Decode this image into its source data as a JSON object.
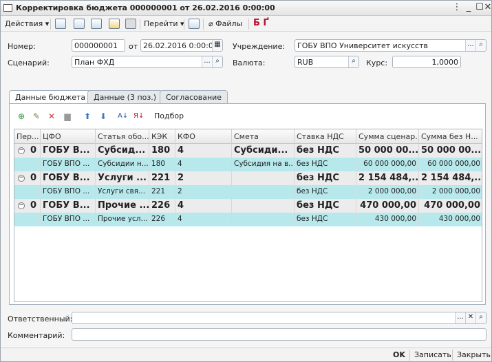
{
  "window": {
    "title": "Корректировка бюджета 000000001 от 26.02.2016 0:00:00"
  },
  "toolbar": {
    "actions": "Действия",
    "goto": "Перейти",
    "files": "Файлы"
  },
  "form": {
    "number_label": "Номер:",
    "number": "000000001",
    "date_label": "от",
    "date": "26.02.2016  0:00:00",
    "org_label": "Учреждение:",
    "org": "ГОБУ ВПО Университет искусств",
    "scenario_label": "Сценарий:",
    "scenario": "План ФХД",
    "currency_label": "Валюта:",
    "currency": "RUB",
    "rate_label": "Курс:",
    "rate": "1,0000"
  },
  "tabs": [
    "Данные бюджета",
    "Данные (3 поз.)",
    "Согласование"
  ],
  "grid_toolbar": {
    "pick": "Подбор"
  },
  "columns": [
    "Пер...",
    "ЦФО",
    "Статья обо...",
    "КЭК",
    "КФО",
    "Смета",
    "Ставка НДС",
    "Сумма сценар...",
    "Сумма без Н..."
  ],
  "rows": [
    {
      "type": "grp",
      "per": "0",
      "cfo": "ГОБУ В...",
      "stat": "Субсид...",
      "kek": "180",
      "kfo": "4",
      "smeta": "Субсиди...",
      "nds": "без НДС",
      "sum": "50 000 00...",
      "sumbn": "50 000 00..."
    },
    {
      "type": "det",
      "per": "",
      "cfo": "ГОБУ ВПО ...",
      "stat": "Субсидии н...",
      "kek": "180",
      "kfo": "4",
      "smeta": "Субсидия на в...",
      "nds": "без НДС",
      "sum": "60 000 000,00",
      "sumbn": "60 000 000,00"
    },
    {
      "type": "grp",
      "per": "0",
      "cfo": "ГОБУ В...",
      "stat": "Услуги ...",
      "kek": "221",
      "kfo": "2",
      "smeta": "",
      "nds": "без НДС",
      "sum": "2 154 484,...",
      "sumbn": "2 154 484,..."
    },
    {
      "type": "det",
      "per": "",
      "cfo": "ГОБУ ВПО ...",
      "stat": "Услуги свя...",
      "kek": "221",
      "kfo": "2",
      "smeta": "",
      "nds": "без НДС",
      "sum": "2 000 000,00",
      "sumbn": "2 000 000,00"
    },
    {
      "type": "grp",
      "per": "0",
      "cfo": "ГОБУ В...",
      "stat": "Прочие ...",
      "kek": "226",
      "kfo": "4",
      "smeta": "",
      "nds": "без НДС",
      "sum": "470 000,00",
      "sumbn": "470 000,00"
    },
    {
      "type": "det",
      "per": "",
      "cfo": "ГОБУ ВПО ...",
      "stat": "Прочие усл...",
      "kek": "226",
      "kfo": "4",
      "smeta": "",
      "nds": "без НДС",
      "sum": "430 000,00",
      "sumbn": "430 000,00"
    }
  ],
  "bottom": {
    "resp_label": "Ответственный:",
    "resp": "",
    "comment_label": "Комментарий:",
    "comment": ""
  },
  "footer": {
    "ok": "OK",
    "save": "Записать",
    "close": "Закрыть"
  }
}
